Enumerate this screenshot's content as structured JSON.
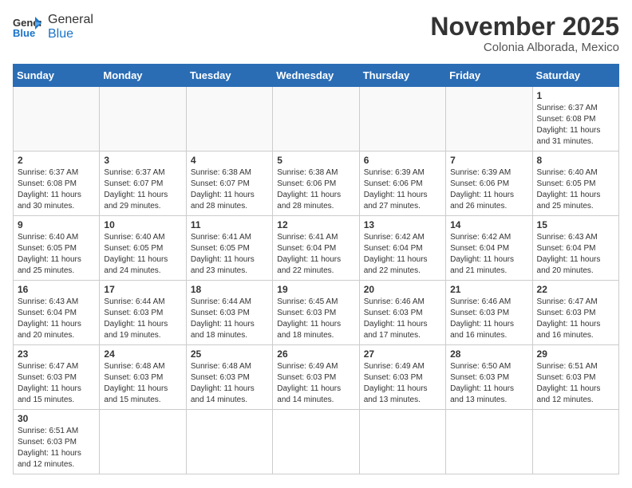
{
  "header": {
    "logo_text_normal": "General",
    "logo_text_blue": "Blue",
    "month_title": "November 2025",
    "location": "Colonia Alborada, Mexico"
  },
  "weekdays": [
    "Sunday",
    "Monday",
    "Tuesday",
    "Wednesday",
    "Thursday",
    "Friday",
    "Saturday"
  ],
  "days": [
    {
      "date": "",
      "info": ""
    },
    {
      "date": "",
      "info": ""
    },
    {
      "date": "",
      "info": ""
    },
    {
      "date": "",
      "info": ""
    },
    {
      "date": "",
      "info": ""
    },
    {
      "date": "",
      "info": ""
    },
    {
      "date": "1",
      "info": "Sunrise: 6:37 AM\nSunset: 6:08 PM\nDaylight: 11 hours\nand 31 minutes."
    },
    {
      "date": "2",
      "info": "Sunrise: 6:37 AM\nSunset: 6:08 PM\nDaylight: 11 hours\nand 30 minutes."
    },
    {
      "date": "3",
      "info": "Sunrise: 6:37 AM\nSunset: 6:07 PM\nDaylight: 11 hours\nand 29 minutes."
    },
    {
      "date": "4",
      "info": "Sunrise: 6:38 AM\nSunset: 6:07 PM\nDaylight: 11 hours\nand 28 minutes."
    },
    {
      "date": "5",
      "info": "Sunrise: 6:38 AM\nSunset: 6:06 PM\nDaylight: 11 hours\nand 28 minutes."
    },
    {
      "date": "6",
      "info": "Sunrise: 6:39 AM\nSunset: 6:06 PM\nDaylight: 11 hours\nand 27 minutes."
    },
    {
      "date": "7",
      "info": "Sunrise: 6:39 AM\nSunset: 6:06 PM\nDaylight: 11 hours\nand 26 minutes."
    },
    {
      "date": "8",
      "info": "Sunrise: 6:40 AM\nSunset: 6:05 PM\nDaylight: 11 hours\nand 25 minutes."
    },
    {
      "date": "9",
      "info": "Sunrise: 6:40 AM\nSunset: 6:05 PM\nDaylight: 11 hours\nand 25 minutes."
    },
    {
      "date": "10",
      "info": "Sunrise: 6:40 AM\nSunset: 6:05 PM\nDaylight: 11 hours\nand 24 minutes."
    },
    {
      "date": "11",
      "info": "Sunrise: 6:41 AM\nSunset: 6:05 PM\nDaylight: 11 hours\nand 23 minutes."
    },
    {
      "date": "12",
      "info": "Sunrise: 6:41 AM\nSunset: 6:04 PM\nDaylight: 11 hours\nand 22 minutes."
    },
    {
      "date": "13",
      "info": "Sunrise: 6:42 AM\nSunset: 6:04 PM\nDaylight: 11 hours\nand 22 minutes."
    },
    {
      "date": "14",
      "info": "Sunrise: 6:42 AM\nSunset: 6:04 PM\nDaylight: 11 hours\nand 21 minutes."
    },
    {
      "date": "15",
      "info": "Sunrise: 6:43 AM\nSunset: 6:04 PM\nDaylight: 11 hours\nand 20 minutes."
    },
    {
      "date": "16",
      "info": "Sunrise: 6:43 AM\nSunset: 6:04 PM\nDaylight: 11 hours\nand 20 minutes."
    },
    {
      "date": "17",
      "info": "Sunrise: 6:44 AM\nSunset: 6:03 PM\nDaylight: 11 hours\nand 19 minutes."
    },
    {
      "date": "18",
      "info": "Sunrise: 6:44 AM\nSunset: 6:03 PM\nDaylight: 11 hours\nand 18 minutes."
    },
    {
      "date": "19",
      "info": "Sunrise: 6:45 AM\nSunset: 6:03 PM\nDaylight: 11 hours\nand 18 minutes."
    },
    {
      "date": "20",
      "info": "Sunrise: 6:46 AM\nSunset: 6:03 PM\nDaylight: 11 hours\nand 17 minutes."
    },
    {
      "date": "21",
      "info": "Sunrise: 6:46 AM\nSunset: 6:03 PM\nDaylight: 11 hours\nand 16 minutes."
    },
    {
      "date": "22",
      "info": "Sunrise: 6:47 AM\nSunset: 6:03 PM\nDaylight: 11 hours\nand 16 minutes."
    },
    {
      "date": "23",
      "info": "Sunrise: 6:47 AM\nSunset: 6:03 PM\nDaylight: 11 hours\nand 15 minutes."
    },
    {
      "date": "24",
      "info": "Sunrise: 6:48 AM\nSunset: 6:03 PM\nDaylight: 11 hours\nand 15 minutes."
    },
    {
      "date": "25",
      "info": "Sunrise: 6:48 AM\nSunset: 6:03 PM\nDaylight: 11 hours\nand 14 minutes."
    },
    {
      "date": "26",
      "info": "Sunrise: 6:49 AM\nSunset: 6:03 PM\nDaylight: 11 hours\nand 14 minutes."
    },
    {
      "date": "27",
      "info": "Sunrise: 6:49 AM\nSunset: 6:03 PM\nDaylight: 11 hours\nand 13 minutes."
    },
    {
      "date": "28",
      "info": "Sunrise: 6:50 AM\nSunset: 6:03 PM\nDaylight: 11 hours\nand 13 minutes."
    },
    {
      "date": "29",
      "info": "Sunrise: 6:51 AM\nSunset: 6:03 PM\nDaylight: 11 hours\nand 12 minutes."
    },
    {
      "date": "30",
      "info": "Sunrise: 6:51 AM\nSunset: 6:03 PM\nDaylight: 11 hours\nand 12 minutes."
    }
  ]
}
